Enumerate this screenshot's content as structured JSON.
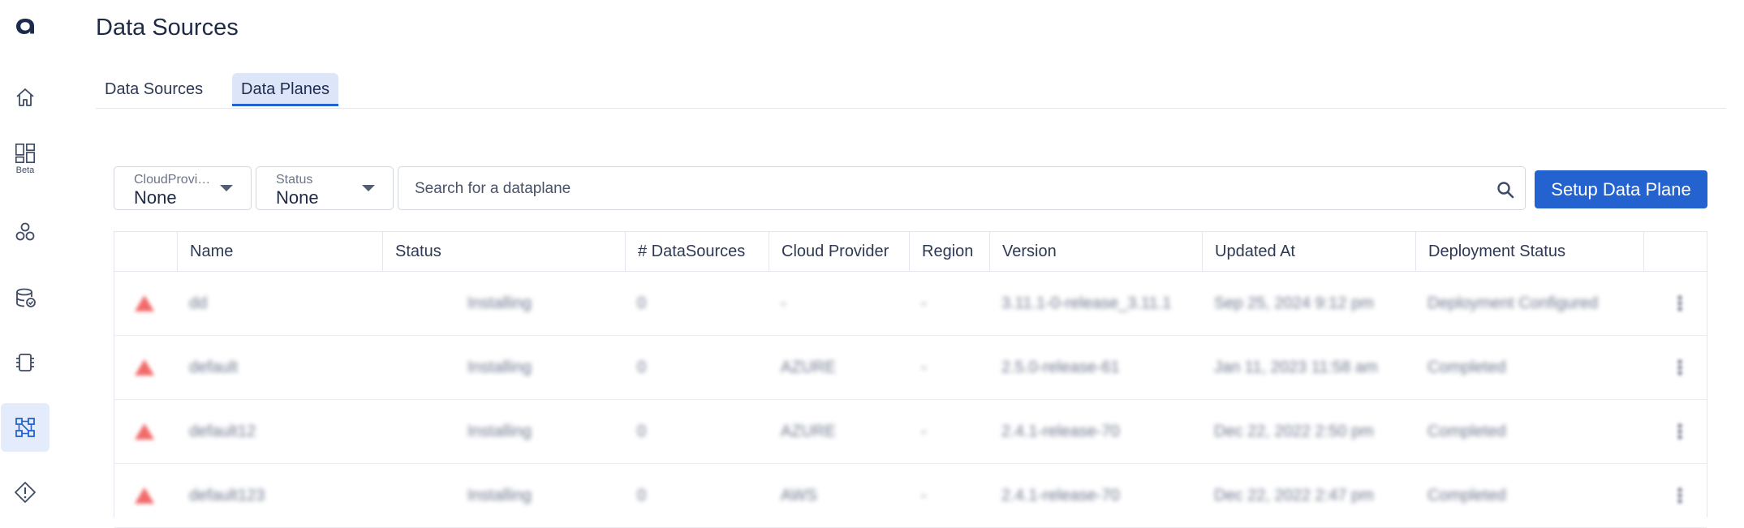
{
  "header": {
    "title": "Data Sources"
  },
  "tabs": [
    {
      "label": "Data Sources",
      "active": false
    },
    {
      "label": "Data Planes",
      "active": true
    }
  ],
  "sidebar": {
    "beta_label": "Beta"
  },
  "filters": {
    "cloud_provider": {
      "label": "CloudProvider",
      "value": "None"
    },
    "status": {
      "label": "Status",
      "value": "None"
    }
  },
  "search": {
    "placeholder": "Search for a dataplane"
  },
  "setup_button": {
    "label": "Setup Data Plane"
  },
  "table": {
    "columns": [
      "Name",
      "Status",
      "# DataSources",
      "Cloud Provider",
      "Region",
      "Version",
      "Updated At",
      "Deployment Status"
    ],
    "rows": [
      {
        "name": "dd",
        "status": "Installing",
        "datasources": "0",
        "cloud": "-",
        "region": "-",
        "version": "3.11.1-0-release_3.11.1",
        "updated": "Sep 25, 2024 9:12 pm",
        "deployment": "Deployment Configured"
      },
      {
        "name": "default",
        "status": "Installing",
        "datasources": "0",
        "cloud": "AZURE",
        "region": "-",
        "version": "2.5.0-release-61",
        "updated": "Jan 11, 2023 11:58 am",
        "deployment": "Completed"
      },
      {
        "name": "default12",
        "status": "Installing",
        "datasources": "0",
        "cloud": "AZURE",
        "region": "-",
        "version": "2.4.1-release-70",
        "updated": "Dec 22, 2022 2:50 pm",
        "deployment": "Completed"
      },
      {
        "name": "default123",
        "status": "Installing",
        "datasources": "0",
        "cloud": "AWS",
        "region": "-",
        "version": "2.4.1-release-70",
        "updated": "Dec 22, 2022 2:47 pm",
        "deployment": "Completed"
      }
    ]
  },
  "colors": {
    "accent": "#2463cf",
    "active_nav_bg": "#e4ecfb",
    "warning": "#f26a6a"
  },
  "icons": [
    "logo-a",
    "home-icon",
    "dashboard-icon",
    "cluster-icon",
    "database-check-icon",
    "chip-icon",
    "dataplane-icon",
    "alert-icon",
    "search-icon",
    "warning-icon",
    "kebab-icon"
  ]
}
